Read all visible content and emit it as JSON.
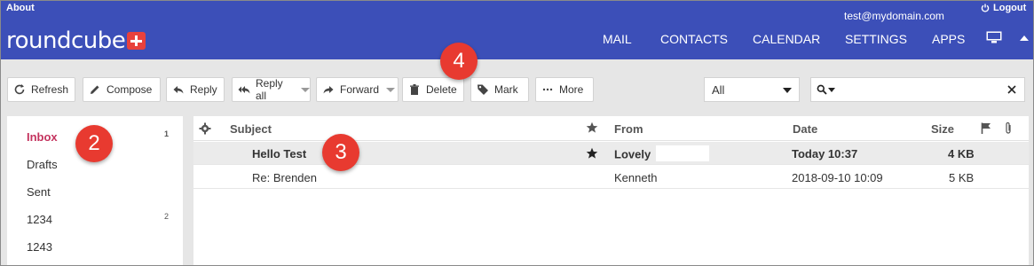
{
  "header": {
    "about": "About",
    "user_email": "test@mydomain.com",
    "logout": "Logout",
    "logo_text": "roundcube",
    "nav": [
      "MAIL",
      "CONTACTS",
      "CALENDAR",
      "SETTINGS",
      "APPS"
    ],
    "bg_color": "#3c4fb8",
    "logo_accent": "#e8413c"
  },
  "toolbar": {
    "refresh": "Refresh",
    "compose": "Compose",
    "reply": "Reply",
    "reply_all": "Reply all",
    "forward": "Forward",
    "delete": "Delete",
    "mark": "Mark",
    "more": "More",
    "filter_value": "All",
    "search_value": "",
    "search_placeholder": ""
  },
  "folders": [
    {
      "name": "Inbox",
      "count": "1",
      "active": true
    },
    {
      "name": "Drafts",
      "count": "",
      "active": false
    },
    {
      "name": "Sent",
      "count": "",
      "active": false
    },
    {
      "name": "1234",
      "count": "2",
      "active": false
    },
    {
      "name": "1243",
      "count": "",
      "active": false
    }
  ],
  "message_list": {
    "columns": {
      "subject": "Subject",
      "from": "From",
      "date": "Date",
      "size": "Size"
    },
    "rows": [
      {
        "subject": "Hello Test",
        "flagged": true,
        "from": "Lovely",
        "date": "Today 10:37",
        "size": "4 KB",
        "unread": true
      },
      {
        "subject": "Re: Brenden",
        "flagged": false,
        "from": "Kenneth",
        "date": "2018-09-10 10:09",
        "size": "5 KB",
        "unread": false
      }
    ]
  },
  "callouts": [
    "2",
    "3",
    "4"
  ],
  "colors": {
    "active_folder": "#c4335e",
    "callout": "#e83a30"
  }
}
